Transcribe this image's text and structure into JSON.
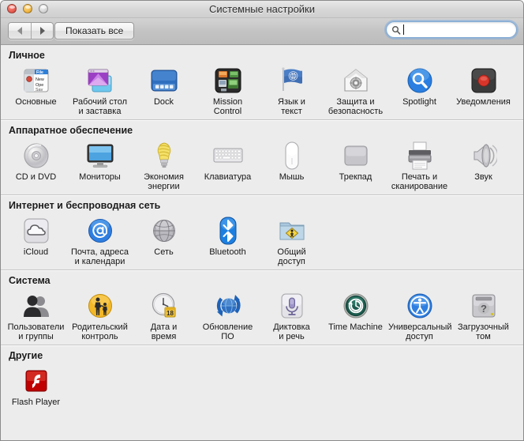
{
  "window": {
    "title": "Системные настройки",
    "traffic_lights": [
      "close-button",
      "minimize-button",
      "zoom-button"
    ]
  },
  "toolbar": {
    "back_label": "back-arrow-icon",
    "forward_label": "forward-arrow-icon",
    "show_all_label": "Показать все",
    "search": {
      "value": "",
      "placeholder": "",
      "icon": "search-icon",
      "focused": true
    }
  },
  "sections": [
    {
      "title": "Личное",
      "items": [
        {
          "label": "Основные",
          "icon": "general-icon"
        },
        {
          "label": "Рабочий стол\nи заставка",
          "icon": "desktop-screensaver-icon"
        },
        {
          "label": "Dock",
          "icon": "dock-icon"
        },
        {
          "label": "Mission\nControl",
          "icon": "mission-control-icon"
        },
        {
          "label": "Язык и\nтекст",
          "icon": "language-text-icon"
        },
        {
          "label": "Защита и\nбезопасность",
          "icon": "security-privacy-icon"
        },
        {
          "label": "Spotlight",
          "icon": "spotlight-icon"
        },
        {
          "label": "Уведомления",
          "icon": "notifications-icon"
        }
      ]
    },
    {
      "title": "Аппаратное обеспечение",
      "items": [
        {
          "label": "CD и DVD",
          "icon": "cd-dvd-icon"
        },
        {
          "label": "Мониторы",
          "icon": "displays-icon"
        },
        {
          "label": "Экономия\nэнергии",
          "icon": "energy-saver-icon"
        },
        {
          "label": "Клавиатура",
          "icon": "keyboard-icon"
        },
        {
          "label": "Мышь",
          "icon": "mouse-icon"
        },
        {
          "label": "Трекпад",
          "icon": "trackpad-icon"
        },
        {
          "label": "Печать и\nсканирование",
          "icon": "print-scan-icon"
        },
        {
          "label": "Звук",
          "icon": "sound-icon"
        }
      ]
    },
    {
      "title": "Интернет и беспроводная сеть",
      "items": [
        {
          "label": "iCloud",
          "icon": "icloud-icon"
        },
        {
          "label": "Почта, адреса\nи календари",
          "icon": "mail-contacts-calendars-icon"
        },
        {
          "label": "Сеть",
          "icon": "network-icon"
        },
        {
          "label": "Bluetooth",
          "icon": "bluetooth-icon"
        },
        {
          "label": "Общий\nдоступ",
          "icon": "sharing-icon"
        }
      ]
    },
    {
      "title": "Система",
      "items": [
        {
          "label": "Пользователи\nи группы",
          "icon": "users-groups-icon"
        },
        {
          "label": "Родительский\nконтроль",
          "icon": "parental-controls-icon"
        },
        {
          "label": "Дата и\nвремя",
          "icon": "date-time-icon"
        },
        {
          "label": "Обновление\nПО",
          "icon": "software-update-icon"
        },
        {
          "label": "Диктовка\nи речь",
          "icon": "dictation-speech-icon"
        },
        {
          "label": "Time Machine",
          "icon": "time-machine-icon"
        },
        {
          "label": "Универсальный\nдоступ",
          "icon": "accessibility-icon"
        },
        {
          "label": "Загрузочный\nтом",
          "icon": "startup-disk-icon"
        }
      ]
    },
    {
      "title": "Другие",
      "items": [
        {
          "label": "Flash Player",
          "icon": "flash-player-icon"
        }
      ]
    }
  ],
  "colors": {
    "window_bg": "#ececec",
    "titlebar_top": "#e8e8e8",
    "toolbar_top": "#d3d3d3",
    "divider": "#c6c6c6",
    "search_focus_ring": "#6ea5e1",
    "date_badge": "#f3c33a",
    "flash_red": "#cc0000",
    "bluetooth_blue": "#1d7fe0",
    "spotlight_blue": "#2a7fe0"
  },
  "date_time_badge": "18"
}
